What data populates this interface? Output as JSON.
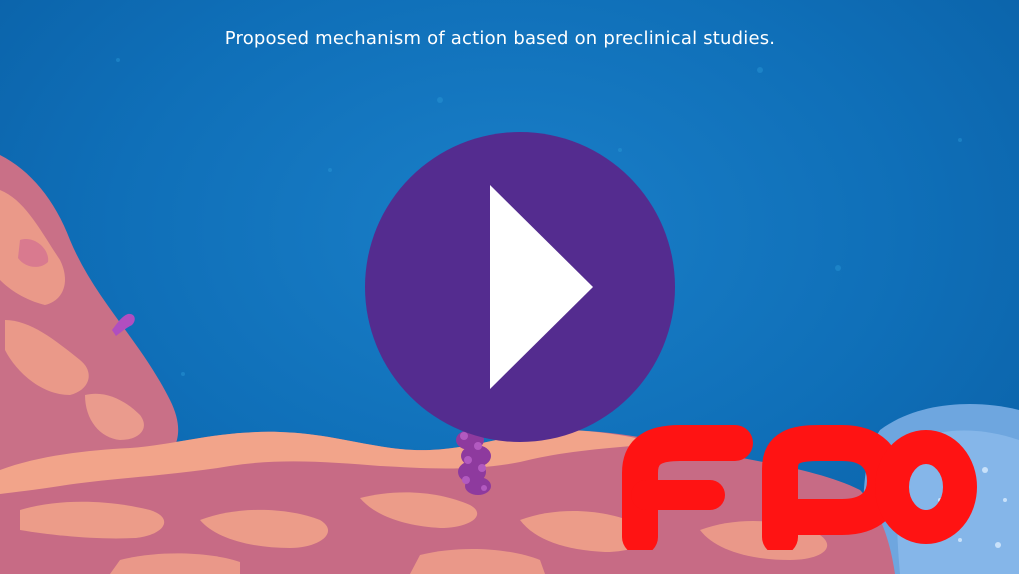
{
  "video": {
    "caption": "Proposed mechanism of action based on preclinical studies.",
    "play_icon": "play-icon",
    "play_button_color": "#542c8f",
    "background_color": "#1173bb"
  },
  "placeholder_mark": {
    "text": "FPO",
    "color": "#ff1313"
  }
}
